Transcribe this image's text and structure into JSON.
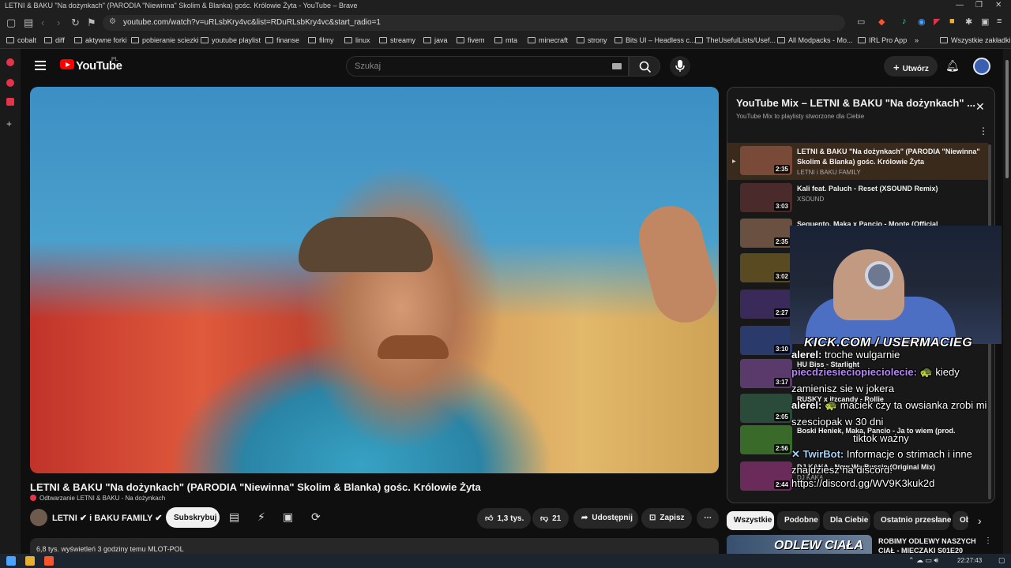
{
  "window": {
    "title": "LETNI & BAKU \"Na dożynkach\" (PARODIA \"Niewinna\" Skolim & Blanka) gośc. Królowie Żyta - YouTube – Brave"
  },
  "browser": {
    "url": "youtube.com/watch?v=uRLsbKry4vc&list=RDuRLsbKry4vc&start_radio=1",
    "bookmarks": [
      "cobalt",
      "diff",
      "aktywne forki",
      "pobieranie sciezki",
      "youtube playlist",
      "finanse",
      "filmy",
      "linux",
      "streamy",
      "java",
      "fivem",
      "mta",
      "minecraft",
      "strony",
      "Bits UI – Headless c...",
      "TheUsefulLists/Usef...",
      "All Modpacks - Mo...",
      "IRL Pro App"
    ],
    "all_bookmarks": "Wszystkie zakładki",
    "more_bookmarks": "»"
  },
  "youtube": {
    "logo_text": "YouTube",
    "country_code": "PL",
    "search_placeholder": "Szukaj",
    "create_label": "Utwórz"
  },
  "video": {
    "title": "LETNI & BAKU \"Na dożynkach\" (PARODIA \"Niewinna\" Skolim & Blanka) gośc. Królowie Żyta",
    "playing_from": "Odtwarzanie LETNI & BAKU - Na dożynkach",
    "channel": "LETNI ✔ i BAKU FAMILY ✔",
    "subscribe_label": "Subskrybuj",
    "likes": "1,3 tys.",
    "dislikes": "21",
    "share_label": "Udostępnij",
    "save_label": "Zapisz",
    "description_preview": "6,8 tys. wyświetleń  3 godziny temu  MLOT-POL"
  },
  "playlist": {
    "title": "YouTube Mix – LETNI & BAKU \"Na dożynkach\" ...",
    "subtitle": "YouTube Mix to playlisty stworzone dla Ciebie",
    "items": [
      {
        "title": "LETNI & BAKU \"Na dożynkach\" (PARODIA \"Niewinna\" Skolim & Blanka) gośc. Królowie Żyta",
        "channel": "LETNI i BAKU FAMILY",
        "duration": "2:35",
        "thumb": "#7a4a38"
      },
      {
        "title": "Kali feat. Paluch - Reset (XSOUND Remix)",
        "channel": "XSOUND",
        "duration": "3:03",
        "thumb": "#4a2a2a"
      },
      {
        "title": "Sequento, Maka x Pancio - Monte (Official",
        "channel": "",
        "duration": "2:35",
        "thumb": "#6a5040"
      },
      {
        "title": "",
        "channel": "",
        "duration": "3:02",
        "thumb": "#5a4a22"
      },
      {
        "title": "",
        "channel": "",
        "duration": "2:27",
        "thumb": "#3a2a5a"
      },
      {
        "title": "",
        "channel": "",
        "duration": "3:10",
        "thumb": "#2a3a6a"
      },
      {
        "title": "HU Biss - Starlight",
        "channel": "",
        "duration": "3:17",
        "thumb": "#5a3a6a"
      },
      {
        "title": "RUSKY x itzcandy - Rollie",
        "channel": "",
        "duration": "2:05",
        "thumb": "#2a4a3a"
      },
      {
        "title": "Boski Heniek, Maka, Pancio - Ja to wiem (prod.",
        "channel": "",
        "duration": "2:56",
        "thumb": "#3a6a2a"
      },
      {
        "title": "DJ KAKA - Now We Bussin (Original Mix)",
        "channel": "DJ KAKA",
        "duration": "2:44",
        "thumb": "#6a2a5a"
      }
    ]
  },
  "overlay": {
    "kick_label": "KICK.COM / USERMACIEG",
    "chat": [
      {
        "name": "alerel:",
        "color": "#ffffff",
        "text": "troche wulgarnie"
      },
      {
        "name": "piecdziesieciopieciolecie:",
        "color": "#b784ff",
        "text": "🐢 kiedy"
      },
      {
        "name": "",
        "color": "#ffffff",
        "text": "zamienisz sie w jokera"
      },
      {
        "name": "alerel:",
        "color": "#ffffff",
        "text": "🐢 maciek czy ta owsianka zrobi mi"
      },
      {
        "name": "",
        "color": "#ffffff",
        "text": "szesciopak w 30 dni"
      },
      {
        "name": "",
        "color": "#ffffff",
        "text": "tiktok ważny"
      },
      {
        "name": "✕ TwirBot:",
        "color": "#9fd4ff",
        "text": "Informacje o strimach i inne"
      },
      {
        "name": "",
        "color": "#ffffff",
        "text": "znajdziesz na discord:"
      },
      {
        "name": "",
        "color": "#ffffff",
        "text": "https://discord.gg/WV9K3kuk2d"
      }
    ]
  },
  "chips": [
    "Wszystkie",
    "Podobne",
    "Dla Ciebie",
    "Ostatnio przesłane",
    "Ob"
  ],
  "related": {
    "thumb_text": "ODLEW CIAŁA",
    "title": "ROBIMY ODLEWY NASZYCH CIAŁ - MIECZAKI S01E20"
  },
  "taskbar": {
    "time": "22:27:43"
  },
  "colors": {
    "bg": "#0f0f0f",
    "accent": "#ff0000",
    "active_row": "#3a2a1c"
  }
}
